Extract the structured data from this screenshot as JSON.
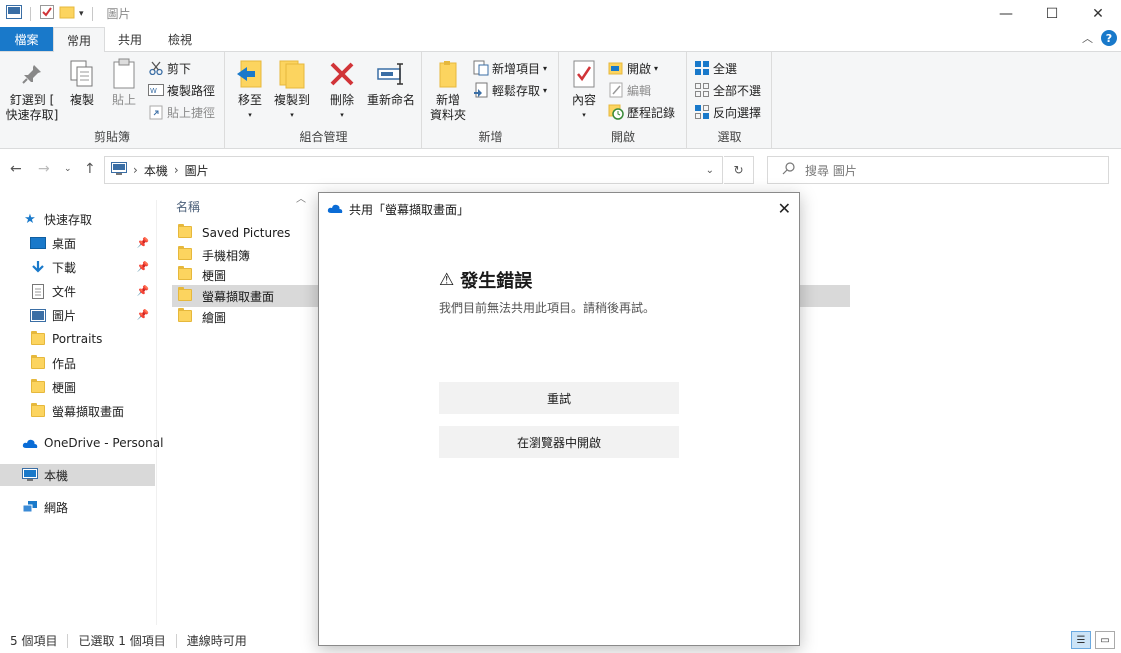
{
  "window": {
    "title": "圖片",
    "controls": {
      "minimize": "—",
      "maximize": "☐",
      "close": "✕"
    }
  },
  "ribbon_tabs": [
    "檔案",
    "常用",
    "共用",
    "檢視"
  ],
  "ribbon": {
    "clipboard": {
      "pin_label_1": "釘選到 [",
      "pin_label_2": "快速存取]",
      "copy": "複製",
      "paste": "貼上",
      "cut": "剪下",
      "copy_path": "複製路徑",
      "paste_shortcut": "貼上捷徑",
      "group_label": "剪貼簿"
    },
    "organize": {
      "move_to": "移至",
      "copy_to": "複製到",
      "delete": "刪除",
      "rename": "重新命名",
      "group_label": "組合管理"
    },
    "new": {
      "new_folder_1": "新增",
      "new_folder_2": "資料夾",
      "new_item": "新增項目",
      "easy_access": "輕鬆存取",
      "group_label": "新增"
    },
    "open": {
      "properties": "內容",
      "open": "開啟",
      "edit": "編輯",
      "history": "歷程記錄",
      "group_label": "開啟"
    },
    "select": {
      "select_all": "全選",
      "select_none": "全部不選",
      "invert": "反向選擇",
      "group_label": "選取"
    }
  },
  "address": {
    "crumbs": [
      "本機",
      "圖片"
    ],
    "search_placeholder": "搜尋 圖片"
  },
  "nav_pane": {
    "quick_access": "快速存取",
    "items": [
      {
        "label": "桌面",
        "pinned": true
      },
      {
        "label": "下載",
        "pinned": true
      },
      {
        "label": "文件",
        "pinned": true
      },
      {
        "label": "圖片",
        "pinned": true
      },
      {
        "label": "Portraits",
        "pinned": false
      },
      {
        "label": "作品",
        "pinned": false
      },
      {
        "label": "梗圖",
        "pinned": false
      },
      {
        "label": "螢幕擷取畫面",
        "pinned": false
      }
    ],
    "onedrive": "OneDrive - Personal",
    "this_pc": "本機",
    "network": "網路"
  },
  "content": {
    "column_name": "名稱",
    "files": [
      "Saved Pictures",
      "手機相簿",
      "梗圖",
      "螢幕擷取畫面",
      "繪圖"
    ],
    "selected_index": 3
  },
  "status": {
    "count": "5 個項目",
    "selected": "已選取 1 個項目",
    "online": "連線時可用"
  },
  "dialog": {
    "title": "共用「螢幕擷取畫面」",
    "heading": "發生錯誤",
    "warning_symbol": "⚠",
    "message": "我們目前無法共用此項目。請稍後再試。",
    "retry": "重試",
    "open_browser": "在瀏覽器中開啟",
    "close": "✕"
  },
  "colors": {
    "accent": "#1979ca",
    "folder": "#fcd45f",
    "delete_red": "#d13438",
    "onedrive_blue": "#0a6cd6"
  }
}
